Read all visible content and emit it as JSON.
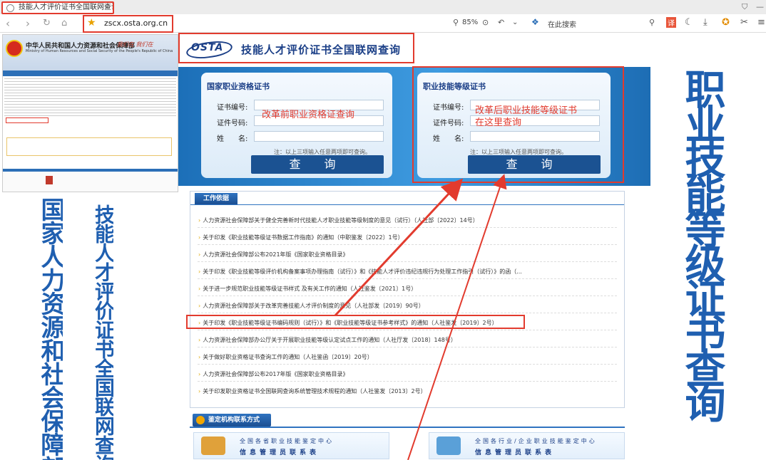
{
  "browser": {
    "tab_title": "技能人才评价证书全国联网查询",
    "url": "zscx.osta.org.cn",
    "zoom": "85%",
    "search_placeholder": "在此搜索"
  },
  "left_page": {
    "ministry_cn": "中华人民共和国人力资源和社会保障部",
    "ministry_en": "Ministry of Human Resources and Social Security of the People's Republic of China",
    "slogan": "我们在 我们在"
  },
  "vertical_texts": {
    "left1": "国家人力资源和社会保障部",
    "left2": "技能人才评价证书全国联网查询",
    "right": "职业技能等级证书查询"
  },
  "site": {
    "logo_text": "OSTA",
    "title": "技能人才评价证书全国联网查询"
  },
  "form_national": {
    "title": "国家职业资格证书",
    "cert_no_label": "证书编号:",
    "id_no_label": "证件号码:",
    "name_label": "姓　　名:",
    "note": "注：以上三项输入任意两项即可查询。",
    "query_button": "查 询"
  },
  "form_skill": {
    "title": "职业技能等级证书",
    "cert_no_label": "证书编号:",
    "id_no_label": "证件号码:",
    "name_label": "姓　　名:",
    "note": "注：以上三项输入任意两项即可查询。",
    "query_button": "查 询"
  },
  "annotations": {
    "before_reform": "改革前职业资格证查询",
    "after_reform": "改革后职业技能等级证书\n在这里查询"
  },
  "work_basis": {
    "tab_label": "工作依据",
    "items": [
      "人力资源社会保障部关于健全完善新时代技能人才职业技能等级制度的意见（试行）（人社部〔2022〕14号）",
      "关于印发《职业技能等级证书数据工作指南》的通知（中职鉴发〔2022〕1号）",
      "人力资源社会保障部公布2021年版《国家职业资格目录》",
      "关于印发《职业技能等级评价机构备案事项办理指南（试行）》和《技能人才评价违纪违规行为处理工作指引（试行）》的函（...",
      "关于进一步规范职业技能等级证书样式 及有关工作的通知（人社鉴发〔2021〕1号）",
      "人力资源社会保障部关于改革完善技能人才评价制度的意见（人社部发〔2019〕90号）",
      "关于印发《职业技能等级证书编码规则（试行）》和《职业技能等级证书参考样式》的通知（人社鉴发〔2019〕2号）",
      "人力资源社会保障部办公厅关于开展职业技能等级认定试点工作的通知（人社厅发〔2018〕148号）",
      "关于做好职业资格证书查询工作的通知（人社鉴函〔2019〕20号）",
      "人力资源社会保障部公布2017年版《国家职业资格目录》",
      "关于印发职业资格证书全国联网查询系统管理技术规程的通知（人社鉴发〔2013〕2号）"
    ]
  },
  "contact": {
    "tab_label": "鉴定机构联系方式",
    "box1_line1": "全国各省职业技能鉴定中心",
    "box1_line2": "信息管理员联系表",
    "box2_line1": "全国各行业/企业职业技能鉴定中心",
    "box2_line2": "信息管理员联系表"
  },
  "colors": {
    "accent_red": "#e23b2e",
    "brand_blue": "#1b3f87",
    "banner_blue": "#2f85d0"
  }
}
